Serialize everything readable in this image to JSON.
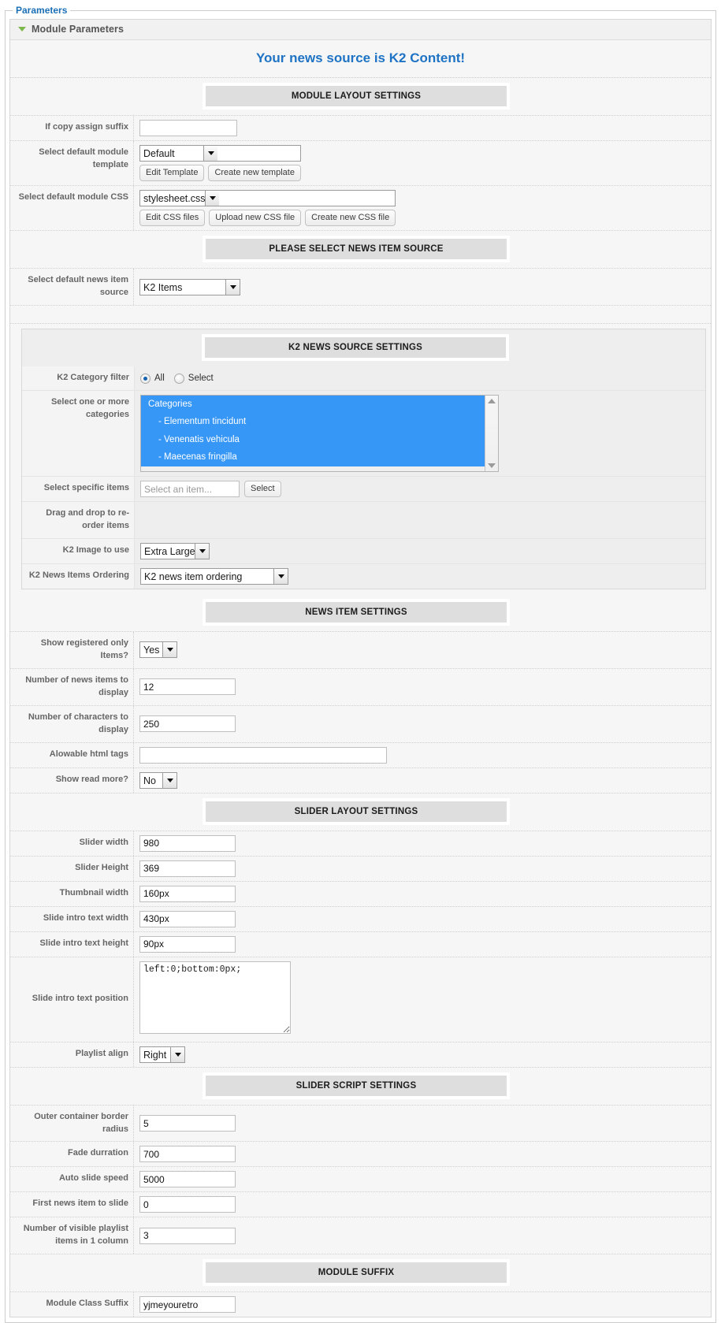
{
  "fieldset": {
    "legend": "Parameters"
  },
  "panel": {
    "title": "Module Parameters",
    "toggle_icon": "triangle-down-icon"
  },
  "page_title": "Your news source is K2 Content!",
  "accent_color": "#1e73c4",
  "sections": {
    "module_layout": "MODULE LAYOUT SETTINGS",
    "please_select": "PLEASE SELECT NEWS ITEM SOURCE",
    "k2_news_source": "K2 NEWS SOURCE SETTINGS",
    "news_item": "NEWS ITEM SETTINGS",
    "slider_layout": "SLIDER LAYOUT SETTINGS",
    "slider_script": "SLIDER SCRIPT SETTINGS",
    "module_suffix": "MODULE SUFFIX"
  },
  "module_layout": {
    "copy_suffix": {
      "label": "If copy assign suffix",
      "value": ""
    },
    "template": {
      "label": "Select default module template",
      "value": "Default",
      "edit_button": "Edit Template",
      "create_button": "Create new template"
    },
    "css": {
      "label": "Select default module CSS",
      "value": "stylesheet.css",
      "edit_button": "Edit CSS files",
      "upload_button": "Upload new CSS file",
      "create_button": "Create new CSS file"
    }
  },
  "news_source": {
    "label": "Select default news item source",
    "value": "K2 Items"
  },
  "k2_source": {
    "category_filter": {
      "label": "K2 Category filter",
      "options": [
        "All",
        "Select"
      ],
      "selected": "All"
    },
    "categories": {
      "label": "Select one or more categories",
      "items": [
        "Categories",
        "- Elementum tincidunt",
        "- Venenatis vehicula",
        "- Maecenas fringilla"
      ]
    },
    "specific_items": {
      "label": "Select specific items",
      "placeholder": "Select an item...",
      "value": "",
      "button": "Select"
    },
    "drag_drop": {
      "label": "Drag and drop to re-order items"
    },
    "image": {
      "label": "K2 Image to use",
      "value": "Extra Large"
    },
    "ordering": {
      "label": "K2 News Items Ordering",
      "value": "K2 news item ordering"
    }
  },
  "news_item": {
    "registered_only": {
      "label": "Show registered only Items?",
      "value": "Yes"
    },
    "num_items": {
      "label": "Number of news items to display",
      "value": "12"
    },
    "num_chars": {
      "label": "Number of characters to display",
      "value": "250"
    },
    "html_tags": {
      "label": "Alowable html tags",
      "value": ""
    },
    "read_more": {
      "label": "Show read more?",
      "value": "No"
    }
  },
  "slider_layout": {
    "width": {
      "label": "Slider width",
      "value": "980"
    },
    "height": {
      "label": "Slider Height",
      "value": "369"
    },
    "thumb_width": {
      "label": "Thumbnail width",
      "value": "160px"
    },
    "intro_width": {
      "label": "Slide intro text width",
      "value": "430px"
    },
    "intro_height": {
      "label": "Slide intro text height",
      "value": "90px"
    },
    "intro_position": {
      "label": "Slide intro text position",
      "value": "left:0;bottom:0px;"
    },
    "playlist_align": {
      "label": "Playlist align",
      "value": "Right"
    }
  },
  "slider_script": {
    "border_radius": {
      "label": "Outer container border radius",
      "value": "5"
    },
    "fade": {
      "label": "Fade durration",
      "value": "700"
    },
    "auto_speed": {
      "label": "Auto slide speed",
      "value": "5000"
    },
    "first_item": {
      "label": "First news item to slide",
      "value": "0"
    },
    "visible_playlist": {
      "label": "Number of visible playlist items in 1 column",
      "value": "3"
    }
  },
  "module_suffix": {
    "class_suffix": {
      "label": "Module Class Suffix",
      "value": "yjmeyouretro"
    }
  }
}
